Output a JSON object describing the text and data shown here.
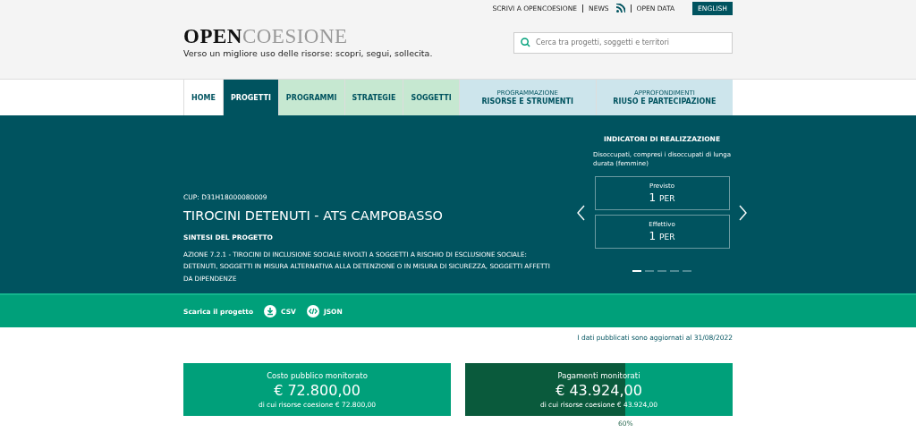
{
  "top_links": [
    {
      "label": "SCRIVI A OPENCOESIONE",
      "kind": "link"
    },
    {
      "label": "NEWS",
      "kind": "link"
    },
    {
      "kind": "rss"
    },
    {
      "label": "OPEN DATA",
      "kind": "link"
    }
  ],
  "language_button": "ENGLISH",
  "logo": {
    "bold": "OPEN",
    "light": "COESIONE",
    "tagline": "Verso un migliore uso delle risorse: scopri, segui, sollecita."
  },
  "search": {
    "placeholder": "Cerca tra progetti, soggetti e territori"
  },
  "nav": [
    {
      "label": "HOME",
      "kind": "plain",
      "selected": false
    },
    {
      "label": "PROGETTI",
      "kind": "plain",
      "selected": true
    },
    {
      "label": "PROGRAMMI",
      "kind": "green",
      "selected": false
    },
    {
      "label": "STRATEGIE",
      "kind": "green",
      "selected": false
    },
    {
      "label": "SOGGETTI",
      "kind": "green",
      "selected": false
    },
    {
      "label": "RISORSE E STRUMENTI",
      "overline": "PROGRAMMAZIONE",
      "kind": "blue",
      "selected": false
    },
    {
      "label": "RIUSO E PARTECIPAZIONE",
      "overline": "APPROFONDIMENTI",
      "kind": "blue",
      "selected": false
    }
  ],
  "project": {
    "cup": "CUP: D31H18000080009",
    "title": "TIROCINI DETENUTI - ATS CAMPOBASSO",
    "summary_heading": "SINTESI DEL PROGETTO",
    "summary": "AZIONE 7.2.1 - TIROCINI DI INCLUSIONE SOCIALE RIVOLTI A SOGGETTI A RISCHIO DI ESCLUSIONE SOCIALE: DETENUTI, SOGGETTI IN MISURA ALTERNATIVA ALLA DETENZIONE O IN MISURA DI SICUREZZA, SOGGETTI AFFETTI DA DIPENDENZE"
  },
  "indicators": {
    "title": "INDICATORI DI REALIZZAZIONE",
    "description": "Disoccupati, compresi i disoccupati di lunga durata (femmine)",
    "boxes": [
      {
        "label": "Previsto",
        "value": "1",
        "unit": "PER"
      },
      {
        "label": "Effettivo",
        "value": "1",
        "unit": "PER"
      }
    ],
    "pages": [
      {
        "selected": true
      },
      {
        "selected": false
      },
      {
        "selected": false
      },
      {
        "selected": false
      },
      {
        "selected": false
      }
    ]
  },
  "download": {
    "label": "Scarica il progetto",
    "formats": [
      {
        "label": "CSV",
        "kind": "download"
      },
      {
        "label": "JSON",
        "kind": "code"
      }
    ]
  },
  "update_note": "I dati pubblicati sono aggiornati al 31/08/2022",
  "cards": [
    {
      "title": "Costo pubblico monitorato",
      "amount": "€ 72.800,00",
      "detail": "di cui risorse coesione € 72.800,00"
    },
    {
      "title": "Pagamenti monitorati",
      "amount": "€ 43.924,00",
      "detail": "di cui risorse coesione € 43.924,00",
      "level": 0.6,
      "percent": "60%"
    }
  ]
}
